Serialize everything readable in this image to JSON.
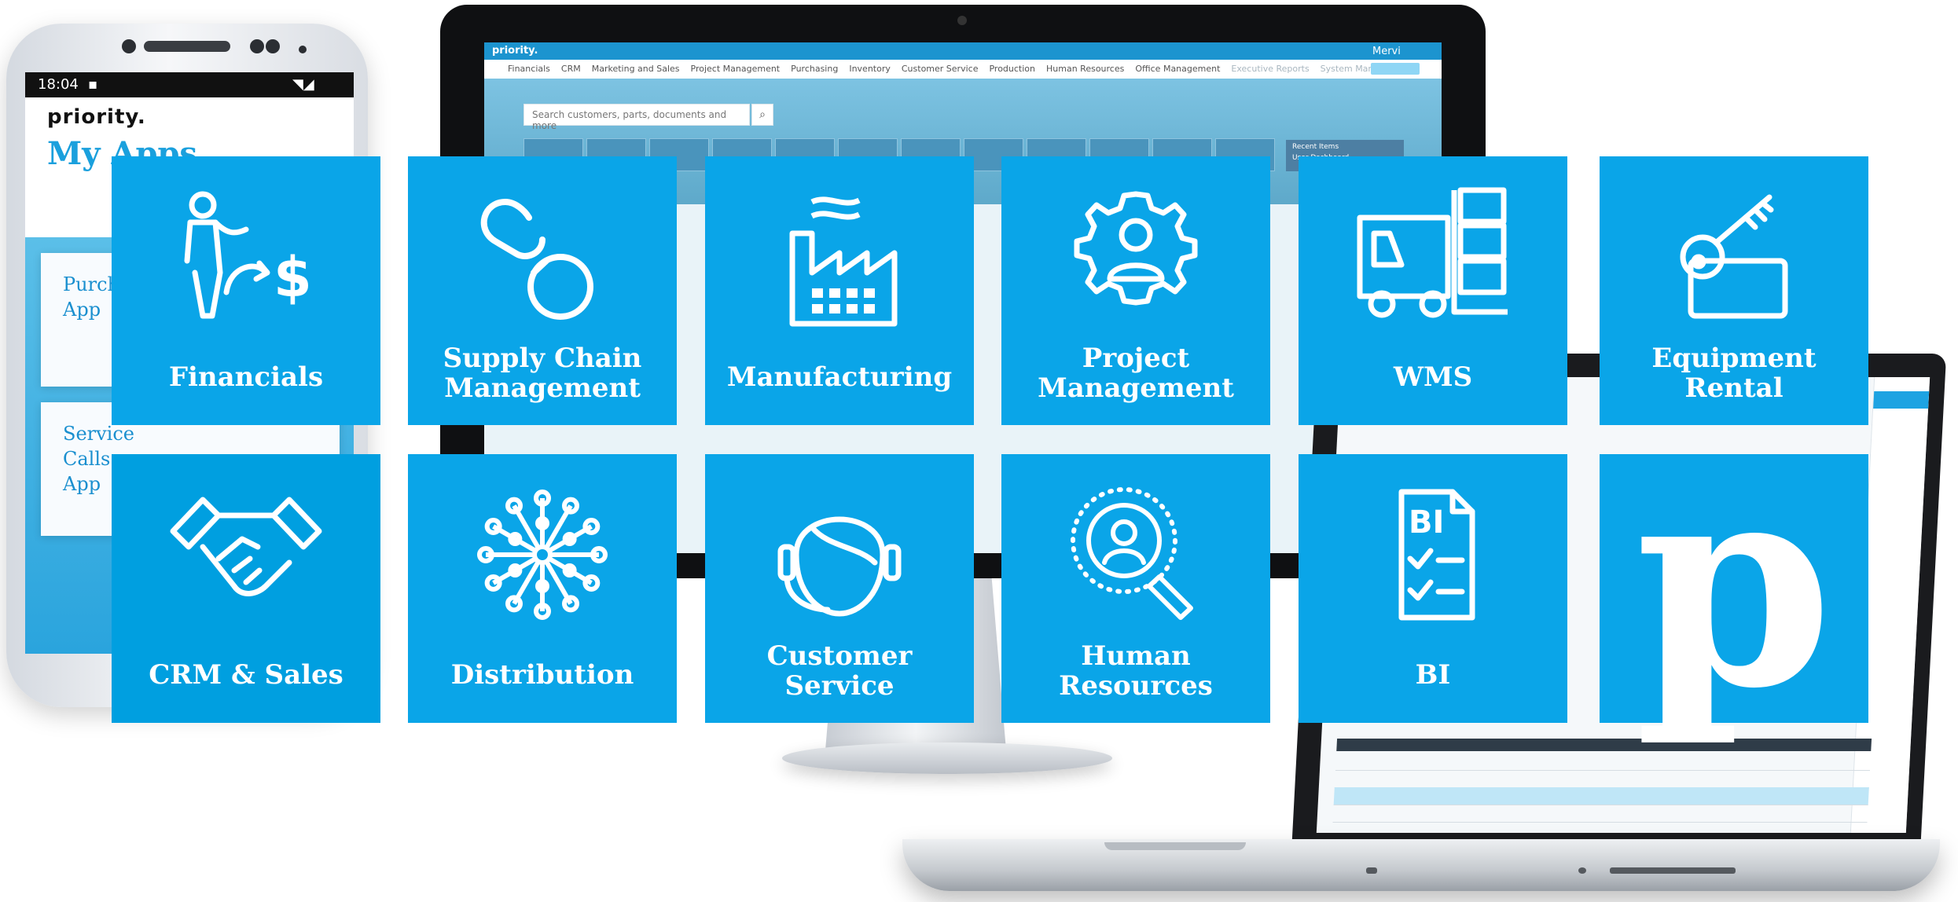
{
  "phone": {
    "time": "18:04",
    "logo": "priority.",
    "title": "My Apps",
    "cards": [
      "Purchasing App",
      "Service Calls App"
    ]
  },
  "monitor": {
    "logo": "priority.",
    "user": "Mervi",
    "nav": [
      "Financials",
      "CRM",
      "Marketing and Sales",
      "Project Management",
      "Purchasing",
      "Inventory",
      "Customer Service",
      "Production",
      "Human Resources",
      "Office Management",
      "Executive Reports",
      "System Management"
    ],
    "search_placeholder": "Search customers, parts, documents and more",
    "panel_title": "Recent Items",
    "panel_item": "User Dashboard"
  },
  "tiles": [
    {
      "label": "Financials",
      "icon": "financials-icon"
    },
    {
      "label": "Supply Chain Management",
      "icon": "chain-link-icon"
    },
    {
      "label": "Manufacturing",
      "icon": "factory-icon"
    },
    {
      "label": "Project Management",
      "icon": "gear-person-icon"
    },
    {
      "label": "WMS",
      "icon": "forklift-icon"
    },
    {
      "label": "Equipment Rental",
      "icon": "key-tag-icon"
    },
    {
      "label": "CRM & Sales",
      "icon": "handshake-icon"
    },
    {
      "label": "Distribution",
      "icon": "network-icon"
    },
    {
      "label": "Customer Service",
      "icon": "headset-agent-icon"
    },
    {
      "label": "Human Resources",
      "icon": "magnifier-person-icon"
    },
    {
      "label": "BI",
      "icon": "bi-report-icon"
    },
    {
      "label": "",
      "icon": "priority-p-logo"
    }
  ],
  "tile_labels": {
    "t0": [
      "Financials"
    ],
    "t1": [
      "Supply Chain",
      "Management"
    ],
    "t2": [
      "Manufacturing"
    ],
    "t3": [
      "Project",
      "Management"
    ],
    "t4": [
      "WMS"
    ],
    "t5": [
      "Equipment",
      "Rental"
    ],
    "t6": [
      "CRM & Sales"
    ],
    "t7": [
      "Distribution"
    ],
    "t8": [
      "Customer",
      "Service"
    ],
    "t9": [
      "Human",
      "Resources"
    ],
    "t10": [
      "BI"
    ]
  },
  "bi_icon_text": "BI",
  "logo_letter": "p",
  "colors": {
    "tile": "#0aa5e8",
    "accent": "#1c94cf",
    "phone_title": "#1aa0dd"
  }
}
